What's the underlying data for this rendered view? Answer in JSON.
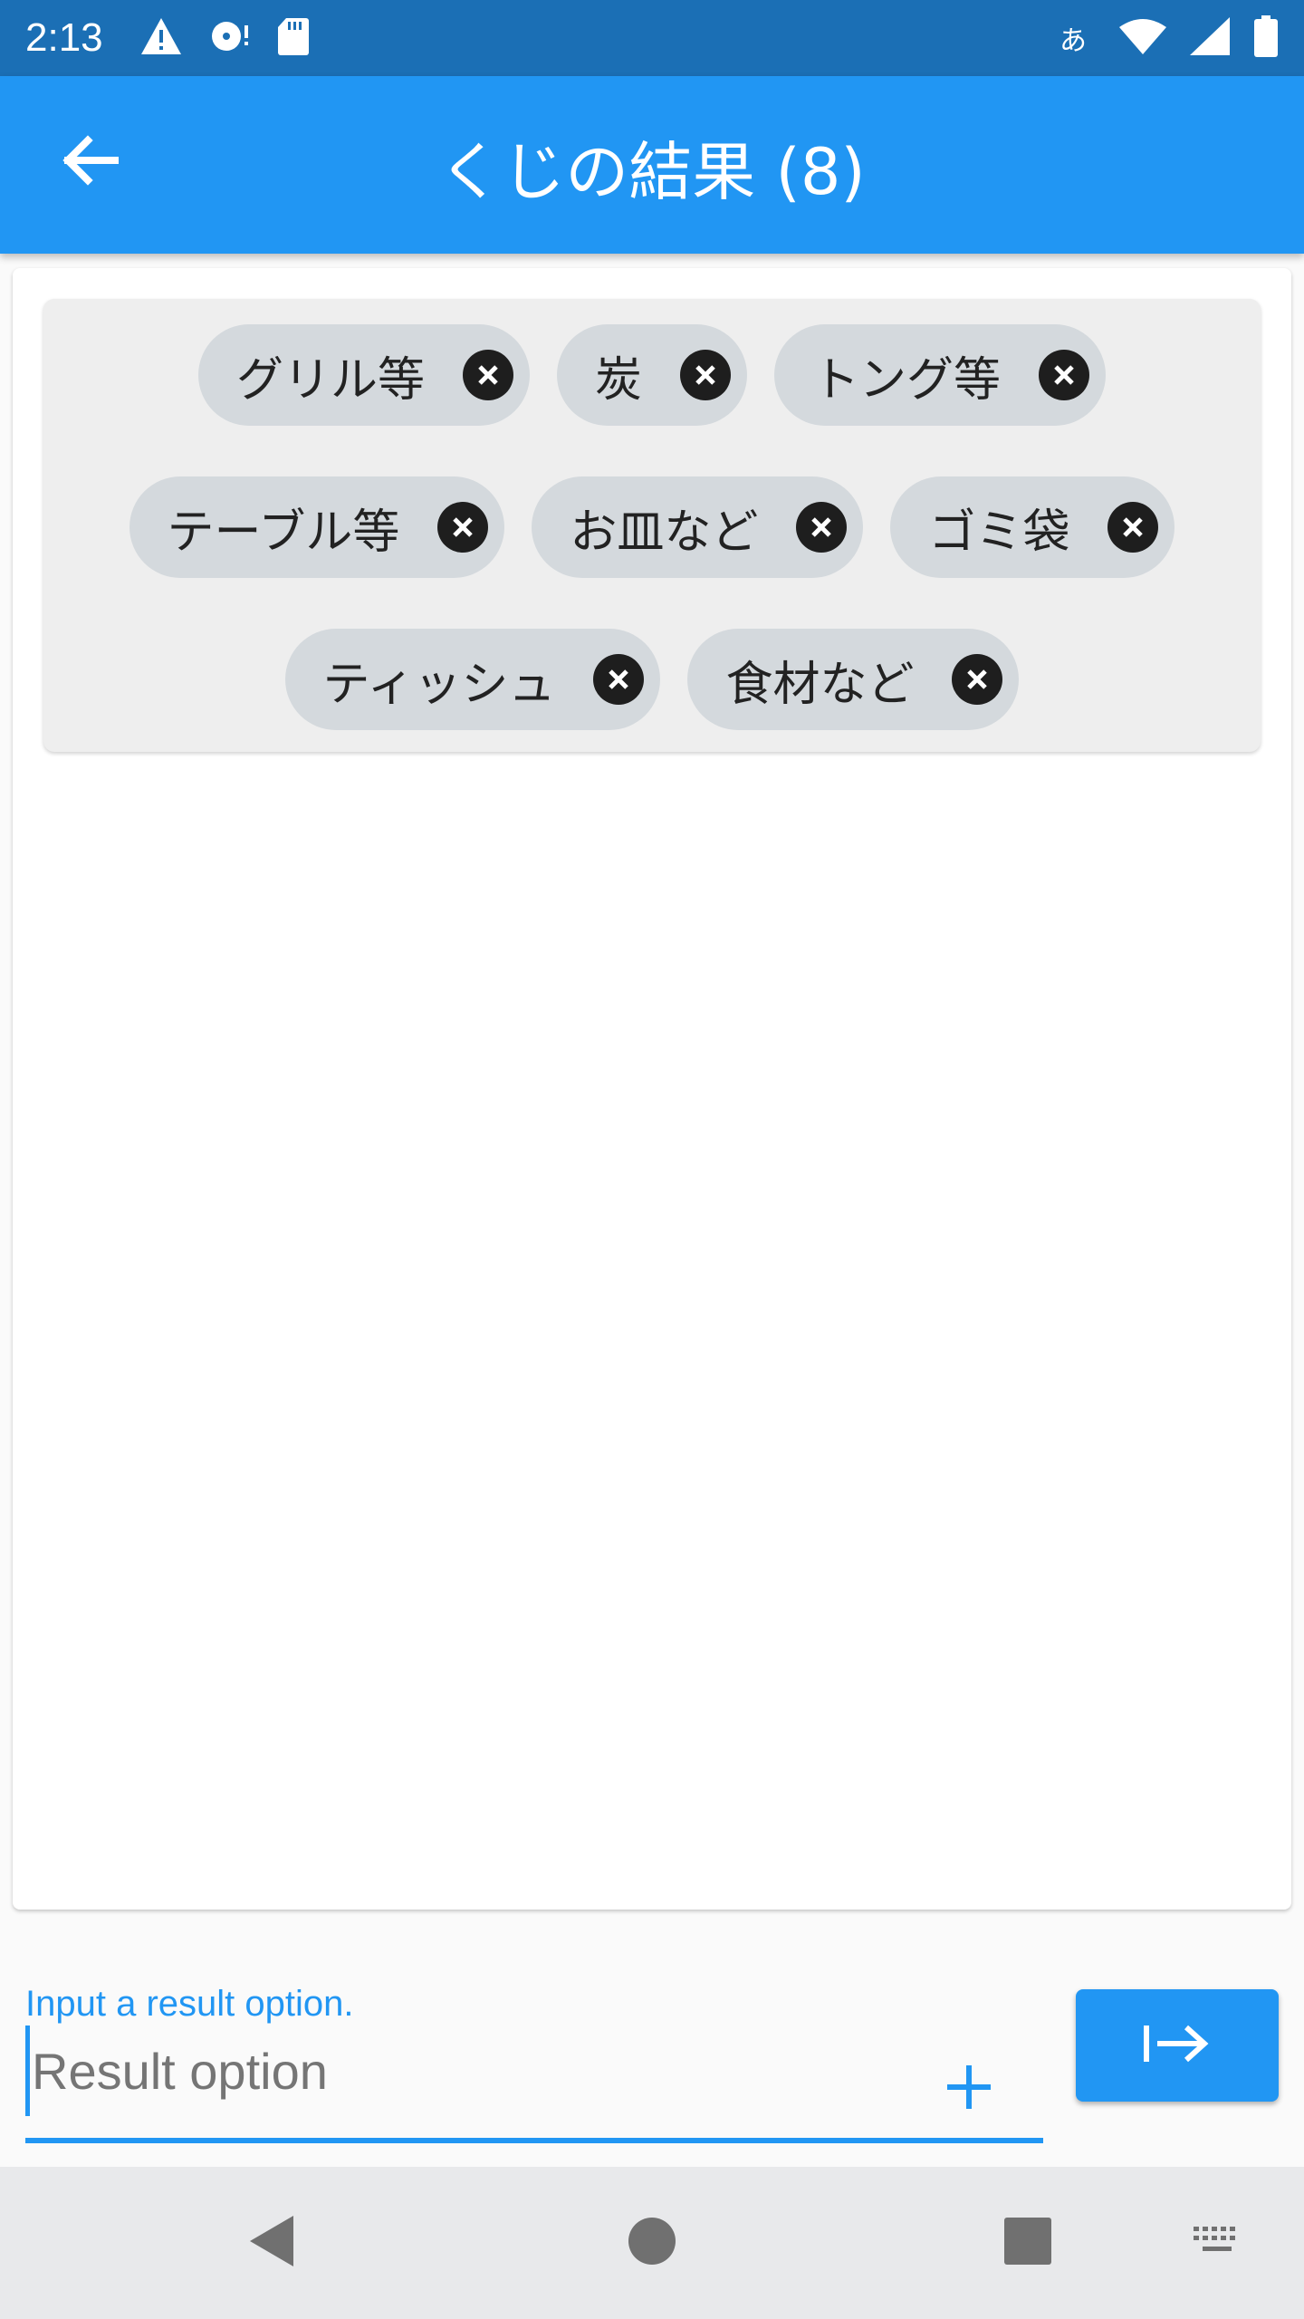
{
  "status_bar": {
    "time": "2:13",
    "left_icons": [
      "warning-icon",
      "disc-icon",
      "sd-card-icon"
    ],
    "ime_indicator": "あ",
    "right_icons": [
      "wifi-icon",
      "cell-signal-icon",
      "battery-icon"
    ]
  },
  "app_bar": {
    "back_icon": "arrow-back-icon",
    "title": "くじの結果 (8)"
  },
  "chips": [
    {
      "label": "グリル等"
    },
    {
      "label": "炭"
    },
    {
      "label": "トング等"
    },
    {
      "label": "テーブル等"
    },
    {
      "label": "お皿など"
    },
    {
      "label": "ゴミ袋"
    },
    {
      "label": "ティッシュ"
    },
    {
      "label": "食材など"
    }
  ],
  "input": {
    "hint": "Input a result option.",
    "placeholder": "Result option",
    "value": "",
    "add_icon": "plus-icon",
    "submit_icon": "arrow-right-to-bar-icon"
  },
  "nav_bar": {
    "buttons": [
      "back-triangle-icon",
      "home-circle-icon",
      "recents-square-icon",
      "keyboard-icon"
    ]
  },
  "colors": {
    "status_bar": "#1b6fb5",
    "primary": "#2196f3",
    "chip_bg": "#d4d9dd",
    "panel_bg": "#eeeeee"
  }
}
